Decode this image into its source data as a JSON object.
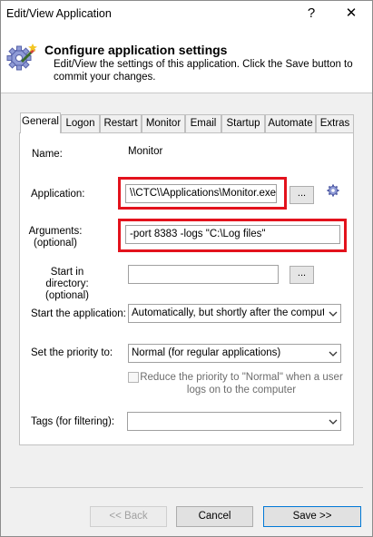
{
  "window": {
    "title": "Edit/View Application",
    "help_glyph": "?",
    "close_glyph": "✕"
  },
  "header": {
    "title": "Configure application settings",
    "description": "Edit/View the settings of this application. Click the Save button to commit your changes.",
    "icon": "gear-wand-icon"
  },
  "tabs": [
    {
      "label": "General",
      "active": true
    },
    {
      "label": "Logon"
    },
    {
      "label": "Restart"
    },
    {
      "label": "Monitor"
    },
    {
      "label": "Email"
    },
    {
      "label": "Startup"
    },
    {
      "label": "Automate"
    },
    {
      "label": "Extras"
    }
  ],
  "form": {
    "name_label": "Name:",
    "name_value": "Monitor",
    "application_label": "Application:",
    "application_value": "\\\\CTC\\\\Applications\\Monitor.exe",
    "browse_label": "...",
    "arguments_label": "Arguments:",
    "arguments_sub": "(optional)",
    "arguments_value": "-port 8383 -logs \"C:\\Log files\"",
    "startdir_label": "Start in directory:",
    "startdir_sub": "(optional)",
    "startdir_value": "",
    "start_label": "Start the application:",
    "start_value": "Automatically, but shortly after the computer b",
    "priority_label": "Set the priority to:",
    "priority_value": "Normal (for regular applications)",
    "reduce_label": "Reduce the priority to \"Normal\" when a user logs on to the computer",
    "reduce_checked": false,
    "tags_label": "Tags (for filtering):",
    "tags_value": ""
  },
  "buttons": {
    "back": "<< Back",
    "cancel": "Cancel",
    "save": "Save >>"
  },
  "colors": {
    "highlight": "#e3121c",
    "accent": "#0078d7"
  }
}
